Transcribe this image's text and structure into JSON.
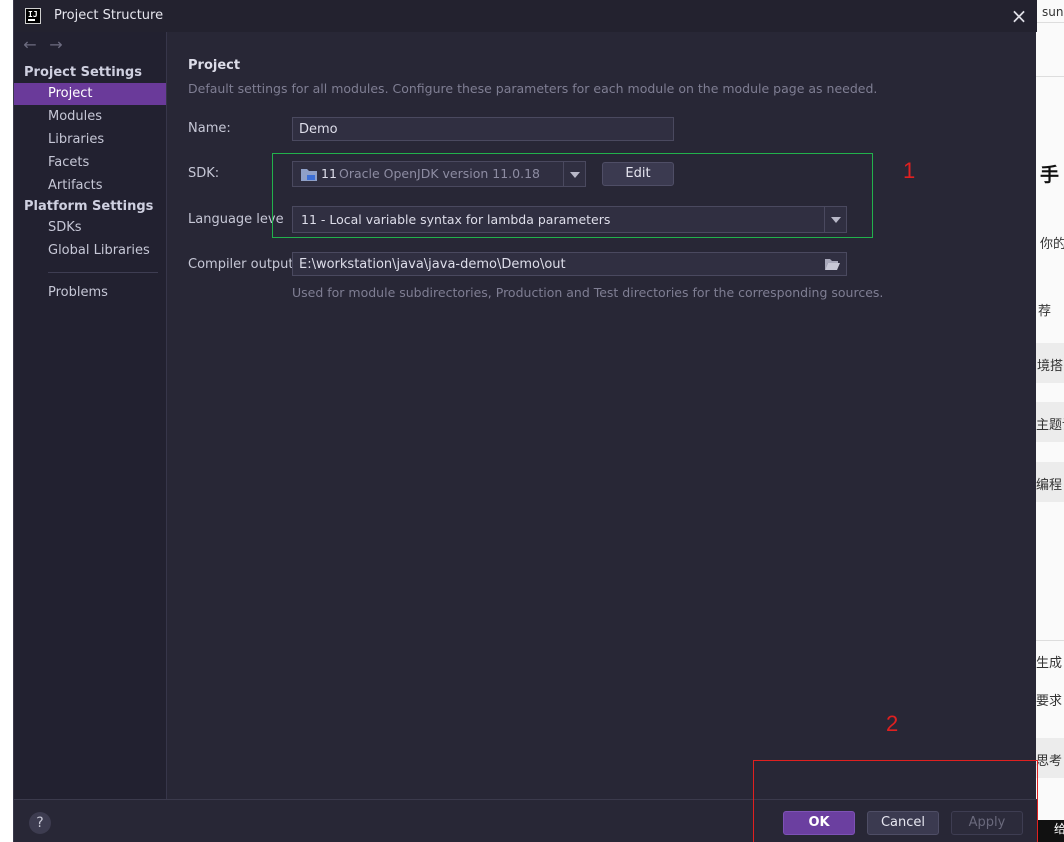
{
  "window": {
    "title": "Project Structure",
    "app_icon_text": "IJ",
    "close_glyph": "×"
  },
  "nav": {
    "back_glyph": "←",
    "forward_glyph": "→"
  },
  "sidebar": {
    "project_settings_header": "Project Settings",
    "project_items": [
      {
        "label": "Project",
        "selected": true
      },
      {
        "label": "Modules"
      },
      {
        "label": "Libraries"
      },
      {
        "label": "Facets"
      },
      {
        "label": "Artifacts"
      }
    ],
    "platform_settings_header": "Platform Settings",
    "platform_items": [
      {
        "label": "SDKs"
      },
      {
        "label": "Global Libraries"
      }
    ],
    "problems_label": "Problems"
  },
  "main": {
    "section_title": "Project",
    "section_desc": "Default settings for all modules. Configure these parameters for each module on the module page as needed.",
    "name_label": "Name:",
    "name_value": "Demo",
    "sdk_label": "SDK:",
    "sdk_version": "11",
    "sdk_name": "Oracle OpenJDK version 11.0.18",
    "edit_label": "Edit",
    "language_label": "Language leve",
    "language_value": "11 - Local variable syntax for lambda parameters",
    "output_label": "Compiler output:",
    "output_value": "E:\\workstation\\java\\java-demo\\Demo\\out",
    "output_hint": "Used for module subdirectories, Production and Test directories for the corresponding sources."
  },
  "annotations": {
    "label_1": "1",
    "label_2": "2",
    "box_1_color": "#22b14c",
    "box_2_color": "#e02020"
  },
  "footer": {
    "help_glyph": "?",
    "ok_label": "OK",
    "cancel_label": "Cancel",
    "apply_label": "Apply"
  },
  "background_page": {
    "texts": [
      "sun",
      "手",
      "你的",
      "荐",
      "境搭",
      "主题设",
      "编程",
      "生成",
      "要求",
      "思考",
      "给"
    ]
  },
  "colors": {
    "accent": "#6a3a9a",
    "dialog_bg": "#282736",
    "sidebar_bg": "#222130"
  }
}
